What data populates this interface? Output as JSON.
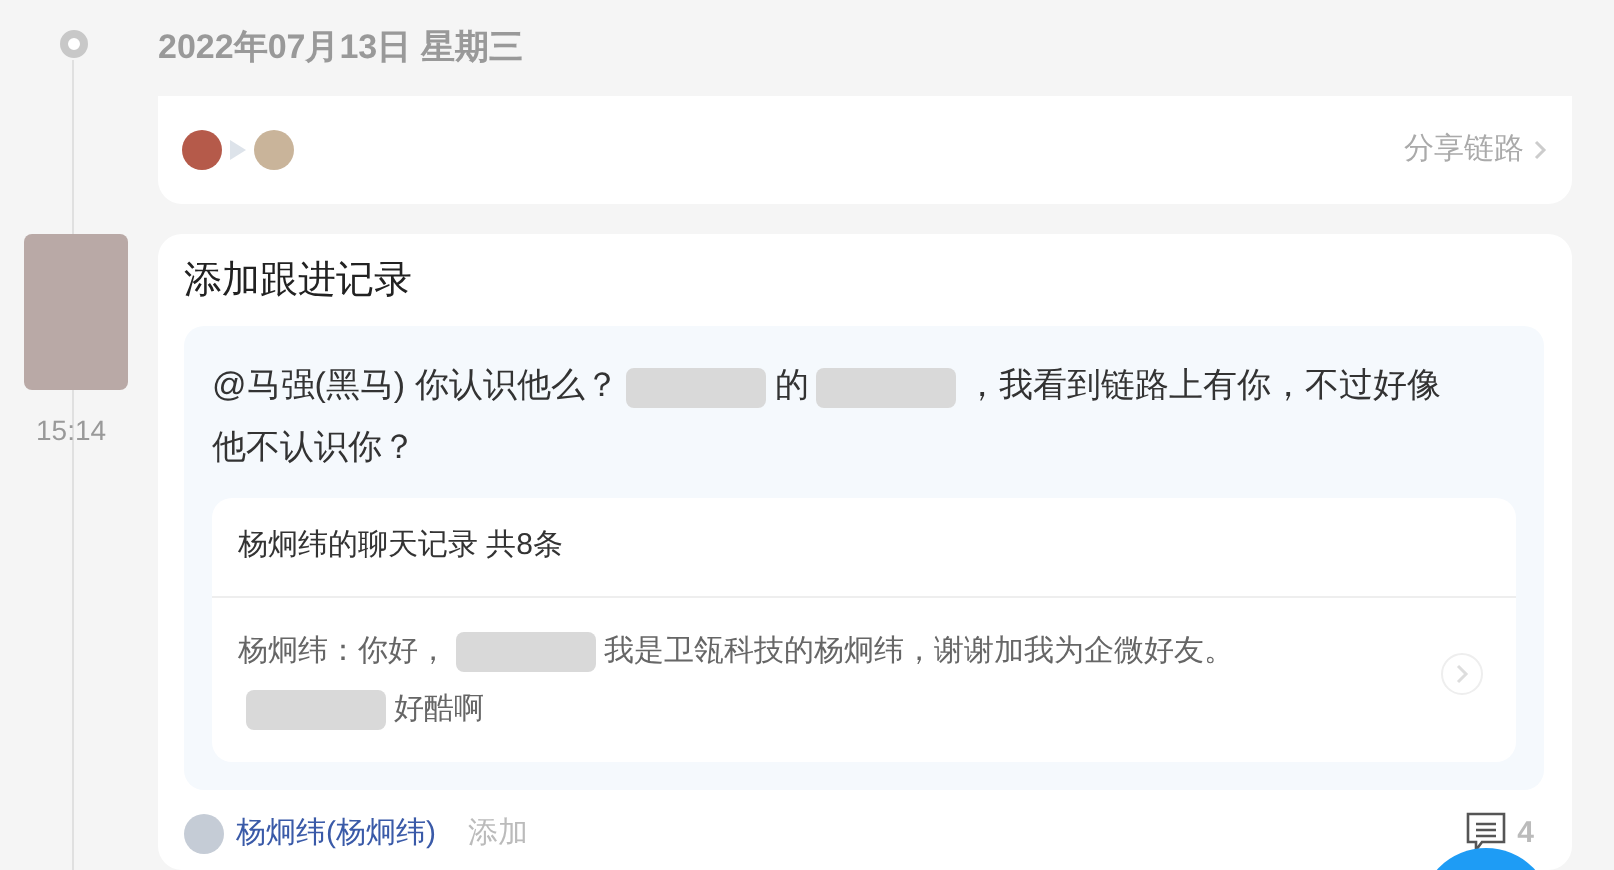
{
  "date_header": "2022年07月13日 星期三",
  "share_card": {
    "link": "分享链路"
  },
  "record": {
    "time": "15:14",
    "title": "添加跟进记录",
    "message": [
      {
        "kind": "text",
        "text": "@马强(黑马) 你认识他么？"
      },
      {
        "kind": "redacted"
      },
      {
        "kind": "text",
        "text": "的"
      },
      {
        "kind": "redacted"
      },
      {
        "kind": "text",
        "text": "，我看到链路上有你，不过好像"
      },
      {
        "kind": "text",
        "text": "他不认识你？"
      }
    ],
    "chat": {
      "title": "杨炯纬的聊天记录 共8条",
      "lines": [
        [
          {
            "kind": "text",
            "text": "杨炯纬：你好，"
          },
          {
            "kind": "redacted"
          },
          {
            "kind": "text",
            "text": "我是卫瓴科技的杨炯纬，谢谢加我为企微好友。"
          }
        ],
        [
          {
            "kind": "redacted"
          },
          {
            "kind": "text",
            "text": "好酷啊"
          }
        ]
      ]
    },
    "author": "杨炯纬(杨炯纬)",
    "action": "添加",
    "comment_count": "4"
  }
}
